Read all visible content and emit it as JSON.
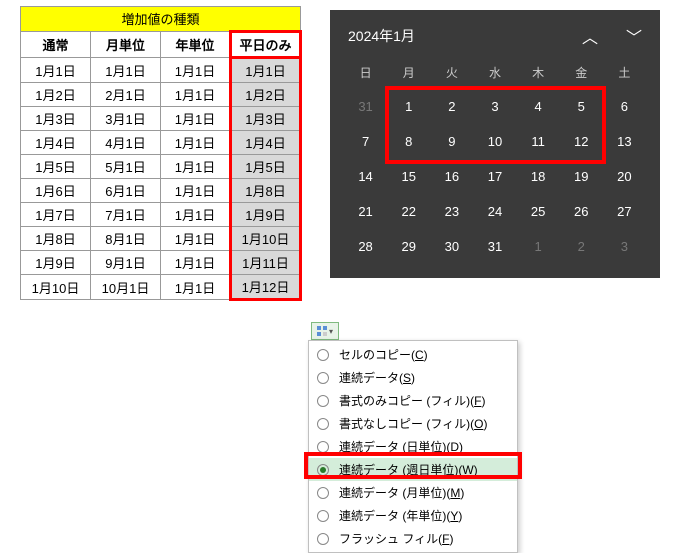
{
  "sheet": {
    "title": "増加値の種類",
    "headers": [
      "通常",
      "月単位",
      "年単位",
      "平日のみ"
    ],
    "rows": [
      [
        "1月1日",
        "1月1日",
        "1月1日",
        "1月1日"
      ],
      [
        "1月2日",
        "2月1日",
        "1月1日",
        "1月2日"
      ],
      [
        "1月3日",
        "3月1日",
        "1月1日",
        "1月3日"
      ],
      [
        "1月4日",
        "4月1日",
        "1月1日",
        "1月4日"
      ],
      [
        "1月5日",
        "5月1日",
        "1月1日",
        "1月5日"
      ],
      [
        "1月6日",
        "6月1日",
        "1月1日",
        "1月8日"
      ],
      [
        "1月7日",
        "7月1日",
        "1月1日",
        "1月9日"
      ],
      [
        "1月8日",
        "8月1日",
        "1月1日",
        "1月10日"
      ],
      [
        "1月9日",
        "9月1日",
        "1月1日",
        "1月11日"
      ],
      [
        "1月10日",
        "10月1日",
        "1月1日",
        "1月12日"
      ]
    ]
  },
  "calendar": {
    "title": "2024年1月",
    "dow": [
      "日",
      "月",
      "火",
      "水",
      "木",
      "金",
      "土"
    ],
    "weeks": [
      [
        {
          "d": "31",
          "dim": true
        },
        {
          "d": "1"
        },
        {
          "d": "2"
        },
        {
          "d": "3"
        },
        {
          "d": "4"
        },
        {
          "d": "5"
        },
        {
          "d": "6"
        }
      ],
      [
        {
          "d": "7"
        },
        {
          "d": "8"
        },
        {
          "d": "9"
        },
        {
          "d": "10"
        },
        {
          "d": "11"
        },
        {
          "d": "12"
        },
        {
          "d": "13"
        }
      ],
      [
        {
          "d": "14"
        },
        {
          "d": "15"
        },
        {
          "d": "16"
        },
        {
          "d": "17"
        },
        {
          "d": "18"
        },
        {
          "d": "19"
        },
        {
          "d": "20"
        }
      ],
      [
        {
          "d": "21"
        },
        {
          "d": "22"
        },
        {
          "d": "23"
        },
        {
          "d": "24"
        },
        {
          "d": "25"
        },
        {
          "d": "26"
        },
        {
          "d": "27"
        }
      ],
      [
        {
          "d": "28"
        },
        {
          "d": "29"
        },
        {
          "d": "30"
        },
        {
          "d": "31"
        },
        {
          "d": "1",
          "dim": true
        },
        {
          "d": "2",
          "dim": true
        },
        {
          "d": "3",
          "dim": true
        }
      ]
    ]
  },
  "menu": {
    "items": [
      {
        "label": "セルのコピー",
        "key": "C",
        "selected": false
      },
      {
        "label": "連続データ",
        "key": "S",
        "selected": false
      },
      {
        "label": "書式のみコピー (フィル)",
        "key": "F",
        "selected": false
      },
      {
        "label": "書式なしコピー (フィル)",
        "key": "O",
        "selected": false
      },
      {
        "label": "連続データ (日単位)",
        "key": "D",
        "selected": false
      },
      {
        "label": "連続データ (週日単位)",
        "key": "W",
        "selected": true
      },
      {
        "label": "連続データ (月単位)",
        "key": "M",
        "selected": false
      },
      {
        "label": "連続データ (年単位)",
        "key": "Y",
        "selected": false
      },
      {
        "label": "フラッシュ フィル",
        "key": "F",
        "selected": false
      }
    ]
  }
}
